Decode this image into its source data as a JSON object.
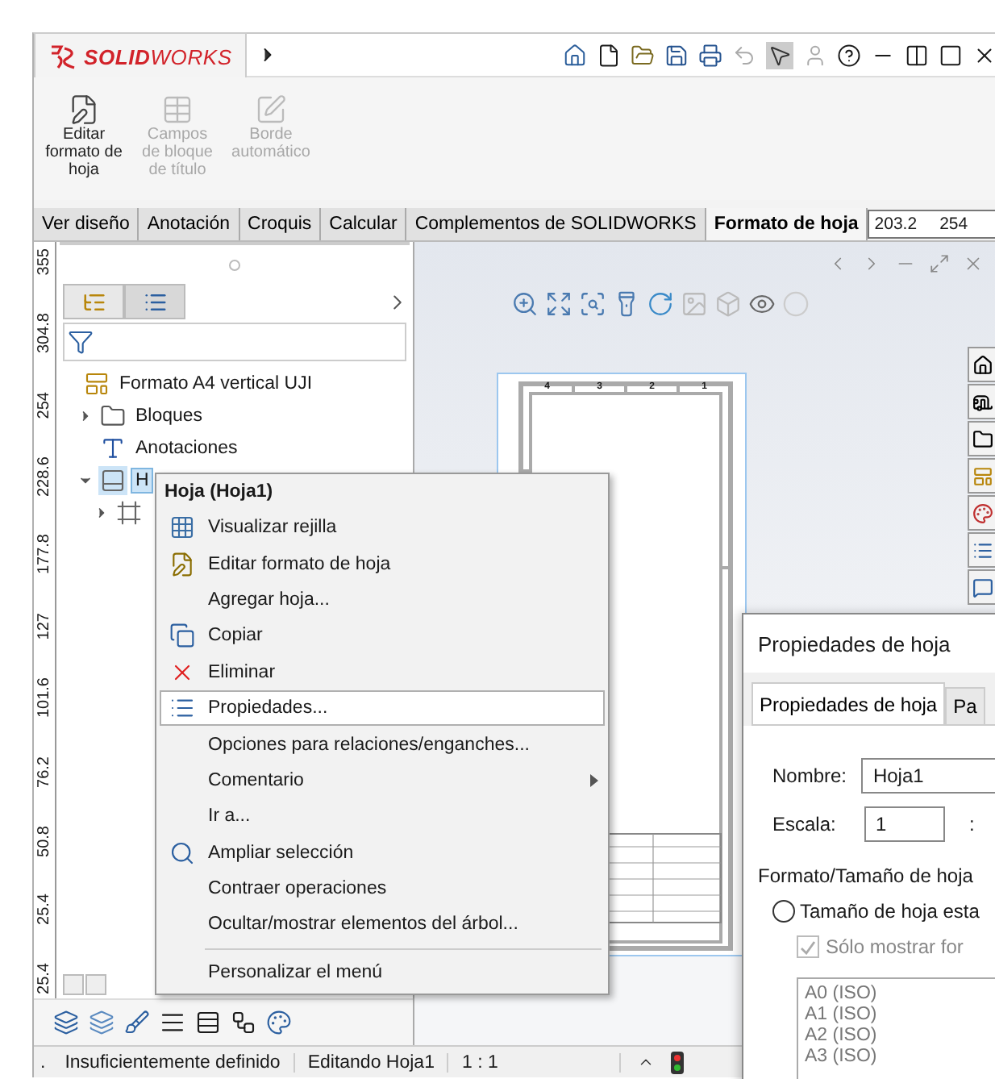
{
  "app_bar": {
    "logo": "**SOLID**WORKS"
  },
  "ribbon": [
    {
      "label": "Editar formato de hoja",
      "disabled": false
    },
    {
      "label": "Campos de bloque de título",
      "disabled": true
    },
    {
      "label": "Borde automático",
      "disabled": true
    }
  ],
  "tabs": [
    {
      "label": "Ver diseño",
      "selected": false
    },
    {
      "label": "Anotación",
      "selected": false
    },
    {
      "label": "Croquis",
      "selected": false
    },
    {
      "label": "Calcular",
      "selected": false
    },
    {
      "label": "Complementos de SOLIDWORKS",
      "selected": false
    },
    {
      "label": "Formato de hoja",
      "selected": true
    }
  ],
  "ruler_field": {
    "start": "203.2",
    "end": "254"
  },
  "ruler_labels": [
    "355",
    "304.8",
    "254",
    "228.6",
    "177.8",
    "127",
    "101.6",
    "76.2",
    "50.8",
    "25.4",
    "25.4"
  ],
  "tree": [
    {
      "label": "Formato A4 vertical UJI",
      "kind": "format",
      "selected": false,
      "children": [
        {
          "label": "Bloques",
          "kind": "blocks",
          "expanded": false,
          "selected": false
        },
        {
          "label": "Anotaciones",
          "kind": "notes",
          "selected": false
        },
        {
          "label": "H",
          "kind": "sheet",
          "expanded": true,
          "selected": true,
          "children": [
            {
              "kind": "view",
              "expanded": false,
              "selected": false
            }
          ]
        }
      ]
    }
  ],
  "context_menu": {
    "title": "Hoja (Hoja1)",
    "items": [
      {
        "kind": "grid",
        "label": "Visualizar rejilla",
        "selected": false,
        "submenu": false
      },
      {
        "kind": "edit",
        "label": "Editar formato de hoja",
        "selected": false,
        "submenu": false
      },
      {
        "kind": "plain",
        "label": "Agregar hoja...",
        "selected": false,
        "submenu": false
      },
      {
        "kind": "copy",
        "label": "Copiar",
        "selected": false,
        "submenu": false
      },
      {
        "kind": "delete",
        "label": "Eliminar",
        "selected": false,
        "submenu": false
      },
      {
        "kind": "properties",
        "label": "Propiedades...",
        "selected": true,
        "submenu": false
      },
      {
        "kind": "plain",
        "label": "Opciones para relaciones/enganches...",
        "selected": false,
        "submenu": false
      },
      {
        "kind": "plain",
        "label": "Comentario",
        "selected": false,
        "submenu": true
      },
      {
        "kind": "plain",
        "label": "Ir a...",
        "selected": false,
        "submenu": false
      },
      {
        "kind": "zoom",
        "label": "Ampliar selección",
        "selected": false,
        "submenu": false
      },
      {
        "kind": "plain",
        "label": "Contraer operaciones",
        "selected": false,
        "submenu": false
      },
      {
        "kind": "plain",
        "label": "Ocultar/mostrar elementos del árbol...",
        "selected": false,
        "submenu": false
      },
      {
        "kind": "separator"
      },
      {
        "kind": "plain",
        "label": "Personalizar el menú",
        "selected": false,
        "submenu": false
      }
    ]
  },
  "canvas": {
    "zone_labels": [
      "4",
      "3",
      "2",
      "1"
    ]
  },
  "dialog": {
    "title": "Propiedades de hoja",
    "tabs": [
      {
        "label": "Propiedades de hoja",
        "selected": true
      },
      {
        "label": "Pa",
        "selected": false
      }
    ],
    "name_label": "Nombre:",
    "name_value": "Hoja1",
    "scale_label": "Escala:",
    "scale_value": "1",
    "scale_separator": ":",
    "group_label": "Formato/Tamaño de hoja",
    "standard_radio": {
      "label": "Tamaño de hoja esta",
      "checked": false
    },
    "only_checkbox": {
      "label": "Sólo mostrar for",
      "checked": true,
      "disabled": true
    },
    "sizes": [
      "A0 (ISO)",
      "A1 (ISO)",
      "A2 (ISO)",
      "A3 (ISO)"
    ]
  },
  "status_bar": {
    "lead": ".",
    "items": [
      "Insuficientemente definido",
      "Editando Hoja1",
      "1 : 1"
    ]
  }
}
